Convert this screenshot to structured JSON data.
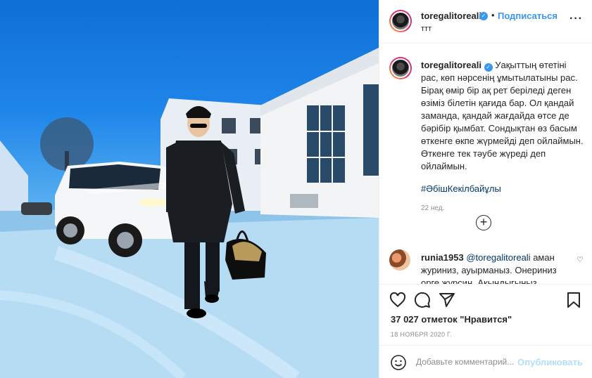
{
  "header": {
    "username": "toregalitoreali",
    "verified_icon": "verified-badge-icon",
    "separator": "•",
    "follow_label": "Подписаться",
    "location": "ттт",
    "more_label": "···"
  },
  "caption": {
    "username": "toregalitoreali",
    "text": "Уақыттың өтетіні рас, көп нәрсенің ұмытылатыны рас. Бірақ өмір бір ақ рет беріледі деген өзіміз білетін қағида бар. Ол қандай заманда, қандай жағдайда өтсе де бәрібір қымбат. Сондықтан өз басым өткенге өкпе жүрмейді деп ойлаймын. Өткенге тек тәубе жүреді деп ойлаймын.",
    "hashtag": "#ӘбішКекілбайұлы",
    "time": "22 нед."
  },
  "load_more_label": "+",
  "comment": {
    "username": "runia1953",
    "mention": "@toregalitoreali",
    "text": "аман журиниз, ауырманыз. Онериниз орге журсин. Акындыгыныз"
  },
  "likes": "37 027 отметок \"Нравится\"",
  "date": "18 НОЯБРЯ 2020 Г.",
  "add_comment": {
    "placeholder": "Добавьте комментарий...",
    "publish_label": "Опубликовать"
  },
  "icons": [
    "heart-icon",
    "comment-icon",
    "share-icon",
    "bookmark-icon",
    "smile-icon",
    "more-icon"
  ],
  "colors": {
    "accent": "#3897f0",
    "text": "#262626",
    "muted": "#8e8e8e",
    "publish_disabled": "#b2dffc"
  }
}
